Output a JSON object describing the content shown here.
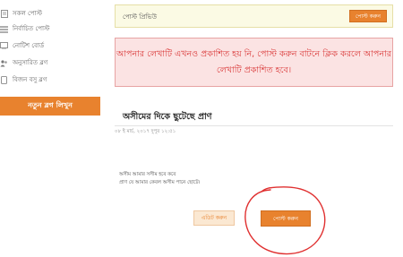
{
  "sidebar": {
    "items": [
      {
        "label": "সকল পোস্ট",
        "icon": "document-icon"
      },
      {
        "label": "নির্বাচিত পোস্ট",
        "icon": "list-icon"
      },
      {
        "label": "নোটিশ বোর্ড",
        "icon": "board-icon"
      },
      {
        "label": "অনুসারিত ব্লগ",
        "icon": "people-icon"
      },
      {
        "label": "বিজন বসু ব্লগ",
        "icon": "page-icon"
      }
    ],
    "new_blog_label": "নতুন ব্লগ লিখুন"
  },
  "preview": {
    "title": "পোস্ট প্রিভিউ",
    "post_button": "পোস্ট করুন"
  },
  "alert": {
    "line1": "আপনার লেখাটি এখনও প্রকাশিত হয় নি, পোস্ট করুন বাটনে ক্লিক করলে আপনার",
    "line2": "লেখাটি প্রকাশিত হবে।"
  },
  "post": {
    "title": "অসীমের দিকে ছুটেছে প্রাণ",
    "date": "০৮ ই মার্চ, ২০১৭ দুপুর ১২:৫১",
    "body_line1": "অসীম আমার সসীম হবে কবে",
    "body_line2": "প্রাণ যে আমার কেবল অসীম পানে ছোটে।"
  },
  "actions": {
    "edit_button": "এডিট করুন",
    "post_button": "পোস্ট করুন"
  },
  "colors": {
    "accent": "#e8822e",
    "alert_text": "#d93636",
    "annotation_circle": "#e03030"
  }
}
